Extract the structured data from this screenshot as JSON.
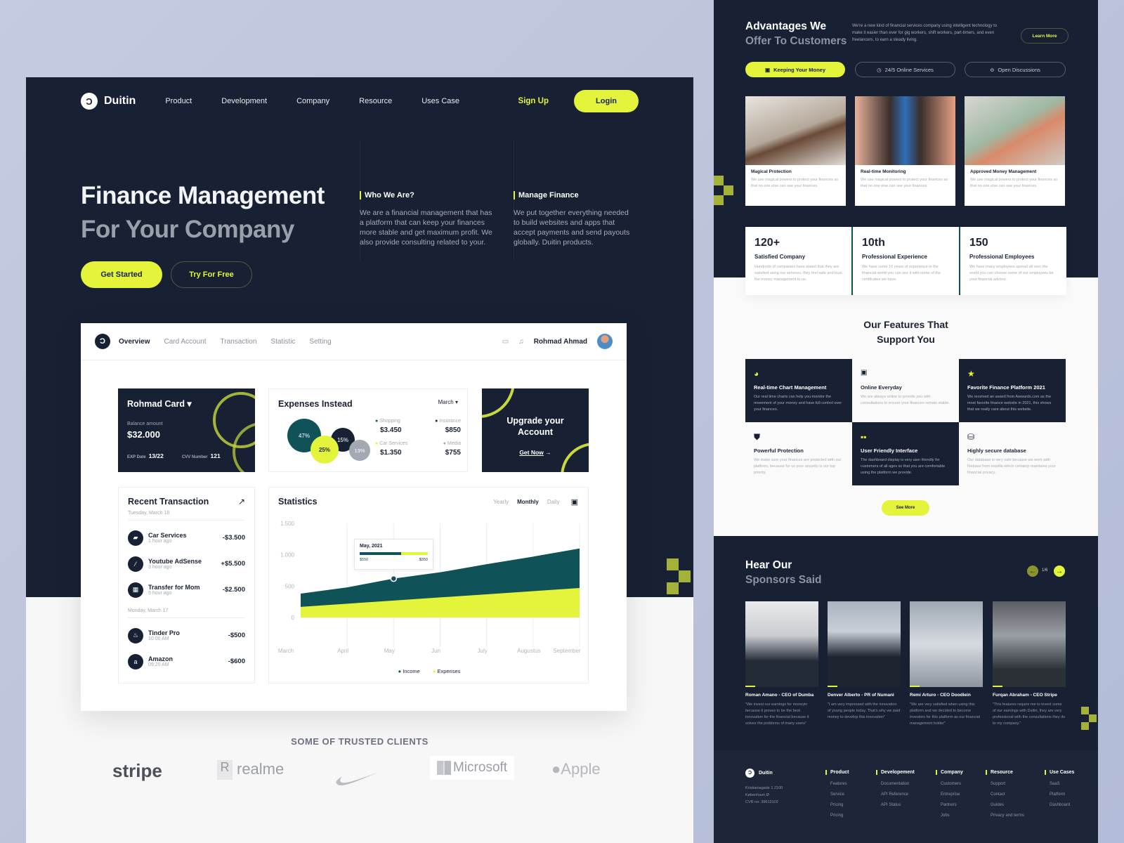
{
  "nav": {
    "brand": "Duitin",
    "links": [
      "Product",
      "Development",
      "Company",
      "Resource",
      "Uses Case"
    ],
    "signup": "Sign Up",
    "login": "Login"
  },
  "hero": {
    "title_line1": "Finance Management",
    "title_line2": "For Your Company",
    "get_started": "Get Started",
    "try_free": "Try For Free",
    "who": {
      "title": "Who We Are?",
      "text": "We are a financial management that has a platform that can keep your finances more stable and get maximum profit. We also provide consulting related to your."
    },
    "manage": {
      "title": "Manage Finance",
      "text": "We put together everything needed to build websites and apps that accept payments and send payouts globally. Duitin products."
    }
  },
  "dashboard": {
    "tabs": [
      "Overview",
      "Card Account",
      "Transaction",
      "Statistic",
      "Setting"
    ],
    "user": "Rohmad Ahmad",
    "card": {
      "name": "Rohmad Card",
      "balance_label": "Balance amount",
      "balance": "$32.000",
      "exp_label": "EXP Date",
      "exp": "13/22",
      "cvv_label": "CVV Number",
      "cvv": "121"
    },
    "expenses": {
      "title": "Expenses Instead",
      "month": "March",
      "bubbles": [
        "47%",
        "25%",
        "15%",
        "13%"
      ],
      "items": [
        {
          "label": "Shopping",
          "value": "$3.450",
          "color": "#0f5257"
        },
        {
          "label": "Insurance",
          "value": "$850",
          "color": "#172133"
        },
        {
          "label": "Car Services",
          "value": "$1.350",
          "color": "#e4f43a"
        },
        {
          "label": "Media",
          "value": "$755",
          "color": "#a3a8b1"
        }
      ]
    },
    "upgrade": {
      "title": "Upgrade your Account",
      "cta": "Get Now"
    },
    "recent": {
      "title": "Recent Transaction",
      "groups": [
        {
          "date": "Tuesday, March 18",
          "items": [
            {
              "name": "Car Services",
              "time": "1 hour ago",
              "amount": "-$3.500",
              "icon": "car"
            },
            {
              "name": "Youtube AdSense",
              "time": "3 hour ago",
              "amount": "+$5.500",
              "icon": "adsense"
            },
            {
              "name": "Transfer for Mom",
              "time": "5 hour ago",
              "amount": "-$2.500",
              "icon": "transfer"
            }
          ]
        },
        {
          "date": "Monday, March 17",
          "items": [
            {
              "name": "Tinder Pro",
              "time": "10:00 AM",
              "amount": "-$500",
              "icon": "fire"
            },
            {
              "name": "Amazon",
              "time": "09:20 AM",
              "amount": "-$600",
              "icon": "a"
            }
          ]
        }
      ]
    },
    "statistics": {
      "title": "Statistics",
      "periods": [
        "Yearly",
        "Monthly",
        "Daily"
      ],
      "active_period": "Monthly",
      "tooltip": {
        "title": "May, 2021",
        "income": "$550",
        "expenses": "$350"
      }
    }
  },
  "chart_data": {
    "type": "area",
    "title": "Statistics",
    "categories": [
      "March",
      "April",
      "May",
      "Jun",
      "July",
      "Augustus",
      "September"
    ],
    "yticks": [
      "1.500",
      "1.000",
      "500",
      "0"
    ],
    "ylim": [
      0,
      1500
    ],
    "series": [
      {
        "name": "Income",
        "color": "#0f5257",
        "values": [
          380,
          480,
          620,
          720,
          850,
          970,
          1100
        ]
      },
      {
        "name": "Expenses",
        "color": "#e4f43a",
        "values": [
          170,
          220,
          270,
          320,
          370,
          420,
          470
        ]
      }
    ],
    "legend": [
      "Income",
      "Expenses"
    ],
    "legend_position": "bottom"
  },
  "clients": {
    "title": "SOME OF TRUSTED CLIENTS",
    "logos": [
      "stripe",
      "realme",
      "nike",
      "Microsoft",
      "Apple"
    ]
  },
  "advantages": {
    "title1": "Advantages We",
    "title2": "Offer To Customers",
    "text": "We're a new kind of financial services company using intelligent technology to make it easier than ever for gig workers, shift workers, part-timers, and even freelancers, to earn a steady living.",
    "learn_more": "Learn More",
    "pills": [
      "Keeping Your Money",
      "24/5 Online Services",
      "Open Discussions"
    ],
    "cards": [
      {
        "title": "Magical Protection",
        "text": "We use magical powers to protect your finances so that no one else can see your finances."
      },
      {
        "title": "Real-time Monitoring",
        "text": "We use magical powers to protect your finances so that no one else can see your finances."
      },
      {
        "title": "Approved Money Management",
        "text": "We use magical powers to protect your finances so that no one else can see your finances."
      }
    ]
  },
  "stats": [
    {
      "num": "120+",
      "label": "Satisfied Company",
      "text": "Hundreds of companies have stated that they are satisfied using our services, they feel safe and trust the money management to us."
    },
    {
      "num": "10th",
      "label": "Professional Experience",
      "text": "We have some 10 years of experience in the financial world you can see it with some of the certificates we have."
    },
    {
      "num": "150",
      "label": "Professional Employees",
      "text": "We have many employees spread all over the world you can choose some of our employees be your financial advisor."
    }
  ],
  "features": {
    "title1": "Our Features That",
    "title2": "Support You",
    "see_more": "See More",
    "items": [
      {
        "title": "Real-time Chart Management",
        "text": "Our real time charts can help you monitor the movement of your money and have full control over your finances."
      },
      {
        "title": "Online Everyday",
        "text": "We are always online to provide you with consultations to ensure your finances remain stable."
      },
      {
        "title": "Favorite Finance Platform 2021",
        "text": "We received an award from Awwards.com as the most favorite finance website in 2021, this shows that we really care about this website."
      },
      {
        "title": "Powerful Protection",
        "text": "We make sure your finances are protected with our platform, because for us your security is our top priority."
      },
      {
        "title": "User Friendly Interface",
        "text": "The dashboard display is very user friendly for customers of all ages so that you are comfortable using the platform we provide."
      },
      {
        "title": "Highly secure database",
        "text": "Our database is very safe because we work with firebase from mozilla which certainly maintains your financial privacy."
      }
    ]
  },
  "sponsors": {
    "title1": "Hear Our",
    "title2": "Sponsors Said",
    "page": "1/6",
    "items": [
      {
        "name": "Roman Amano - CEO of Dumba",
        "quote": "\"We invest our earnings for moneyin because it proves to be the best innovation for the financial because it solves the problems of many users\""
      },
      {
        "name": "Denver Alberto - PR of Numani",
        "quote": "\"I am very impressed with the innovation of young people today. That's why we paid money to develop this innovation\""
      },
      {
        "name": "Remi Arturo - CEO Doodlein",
        "quote": "\"We are very satisfied when using this platform and we decided to become investors for this platform as our financial management holder\""
      },
      {
        "name": "Furqan Abraham - CEO Stripe",
        "quote": "\"This features require me to invest some of our earnings with Duitin, they are very professional with the consultations they do to my company.\""
      }
    ]
  },
  "footer": {
    "brand": "Duitin",
    "address": [
      "Kristianiagade 1 2100",
      "København Ø",
      "CVR no: 39613102"
    ],
    "cols": [
      {
        "h": "Product",
        "items": [
          "Features",
          "Service",
          "Pricing",
          "Pricing"
        ]
      },
      {
        "h": "Developement",
        "items": [
          "Documentation",
          "API Reference",
          "API Status"
        ]
      },
      {
        "h": "Company",
        "items": [
          "Customers",
          "Entreprise",
          "Partners",
          "Jobs"
        ]
      },
      {
        "h": "Resource",
        "items": [
          "Support",
          "Contact",
          "Guides",
          "Privacy and terms"
        ]
      },
      {
        "h": "Use Cases",
        "items": [
          "SaaS",
          "Platform",
          "Dashboard"
        ]
      }
    ]
  }
}
